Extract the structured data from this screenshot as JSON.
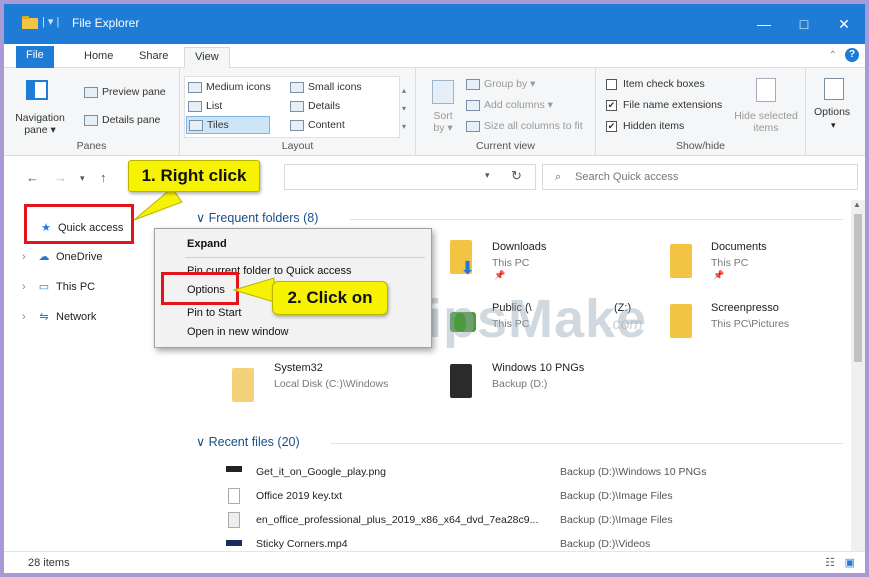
{
  "window": {
    "title": "File Explorer",
    "minimize": "—",
    "maximize": "□",
    "close": "✕"
  },
  "tabs": [
    {
      "label": "File"
    },
    {
      "label": "Home"
    },
    {
      "label": "Share"
    },
    {
      "label": "View"
    }
  ],
  "ribbon": {
    "panes": {
      "label": "Panes",
      "navigation_pane": "Navigation pane ▾",
      "preview_pane": "Preview pane",
      "details_pane": "Details pane"
    },
    "layout": {
      "label": "Layout",
      "medium_icons": "Medium icons",
      "small_icons": "Small icons",
      "list": "List",
      "details": "Details",
      "tiles": "Tiles",
      "content": "Content"
    },
    "current_view": {
      "label": "Current view",
      "sort_by": "Sort by ▾",
      "group_by": "Group by ▾",
      "add_columns": "Add columns ▾",
      "size_all": "Size all columns to fit"
    },
    "show_hide": {
      "label": "Show/hide",
      "item_check_boxes": "Item check boxes",
      "file_name_extensions": "File name extensions",
      "hidden_items": "Hidden items",
      "hide_selected": "Hide selected items"
    },
    "options": "Options"
  },
  "address": {
    "search_placeholder": "Search Quick access"
  },
  "nav": {
    "items": [
      {
        "label": "Quick access"
      },
      {
        "label": "OneDrive"
      },
      {
        "label": "This PC"
      },
      {
        "label": "Network"
      }
    ]
  },
  "frequent": {
    "header": "Frequent folders (8)",
    "folders": [
      {
        "name": "Downloads",
        "sub": "This PC"
      },
      {
        "name": "Documents",
        "sub": "This PC"
      },
      {
        "name": "Public (\\",
        "sub": "This PC",
        "extra": "(Z:)"
      },
      {
        "name": "Screenpresso",
        "sub": "This PC\\Pictures"
      },
      {
        "name": "System32",
        "sub": "Local Disk (C:)\\Windows"
      },
      {
        "name": "Windows 10 PNGs",
        "sub": "Backup (D:)"
      }
    ]
  },
  "recent": {
    "header": "Recent files (20)",
    "files": [
      {
        "name": "Get_it_on_Google_play.png",
        "loc": "Backup (D:)\\Windows 10 PNGs"
      },
      {
        "name": "Office 2019 key.txt",
        "loc": "Backup (D:)\\Image Files"
      },
      {
        "name": "en_office_professional_plus_2019_x86_x64_dvd_7ea28c9...",
        "loc": "Backup (D:)\\Image Files"
      },
      {
        "name": "Sticky Corners.mp4",
        "loc": "Backup (D:)\\Videos"
      }
    ]
  },
  "context_menu": {
    "items": [
      {
        "label": "Expand"
      },
      {
        "label": "Pin current folder to Quick access"
      },
      {
        "label": "Options"
      },
      {
        "label": "Pin to Start"
      },
      {
        "label": "Open in new window"
      }
    ]
  },
  "annotations": {
    "step1": "1. Right click",
    "step2": "2. Click on"
  },
  "watermark": {
    "main": "TipsMake",
    "suffix": ".com"
  },
  "status": {
    "items": "28 items"
  },
  "colors": {
    "titlebar": "#1f7cd6",
    "callout": "#f7f200",
    "highlight": "#e2141c",
    "frame": "#a99ad6"
  }
}
